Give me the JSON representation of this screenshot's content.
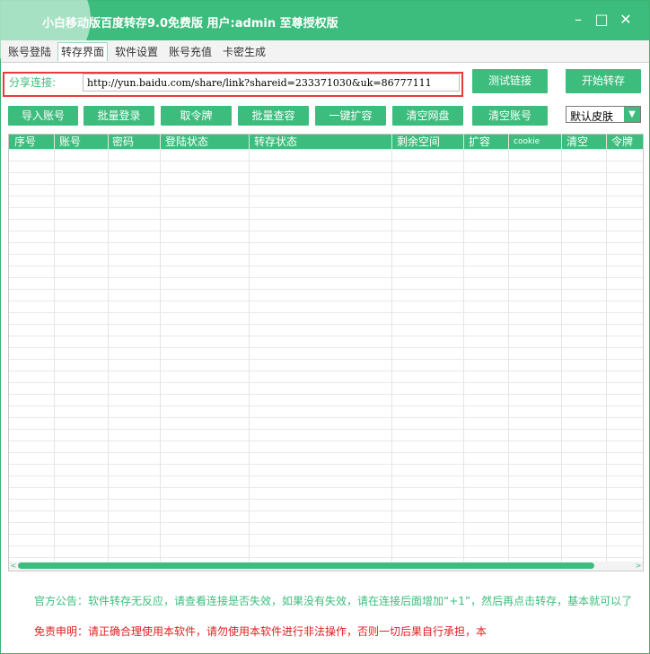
{
  "window": {
    "title": "小白移动版百度转存9.0免费版 用户:admin 至尊授权版",
    "controls": {
      "minimize": "–",
      "maximize": "□",
      "close": "✕"
    }
  },
  "tabs": [
    {
      "label": "账号登陆"
    },
    {
      "label": "转存界面",
      "active": true
    },
    {
      "label": "软件设置"
    },
    {
      "label": "账号充值"
    },
    {
      "label": "卡密生成"
    }
  ],
  "share": {
    "label": "分享连接:",
    "value": "http://yun.baidu.com/share/link?shareid=233371030&uk=86777111"
  },
  "buttons": {
    "test_link": "测试链接",
    "start_transfer": "开始转存",
    "import_accounts": "导入账号",
    "batch_login": "批量登录",
    "get_token": "取令牌",
    "batch_query": "批量查容",
    "one_key_expand": "一键扩容",
    "clear_netdisk": "清空网盘",
    "clear_accounts": "清空账号"
  },
  "skin": {
    "selected": "默认皮肤",
    "arrow_icon": "chevron-down-icon"
  },
  "table": {
    "columns": [
      "序号",
      "账号",
      "密码",
      "登陆状态",
      "转存状态",
      "剩余空间",
      "扩容",
      "cookie",
      "清空",
      "令牌"
    ],
    "rows": []
  },
  "footer": {
    "notice": "官方公告：软件转存无反应，请查看连接是否失效，如果没有失效，请在连接后面增加“+1”，然后再点击转存，基本就可以了",
    "disclaimer": "免责申明：请正确合理使用本软件，请勿使用本软件进行非法操作，否则一切后果自行承担，本"
  },
  "colors": {
    "accent": "#3dbd7d",
    "highlight_border": "#e63b3b",
    "disclaimer_text": "#e02020"
  }
}
